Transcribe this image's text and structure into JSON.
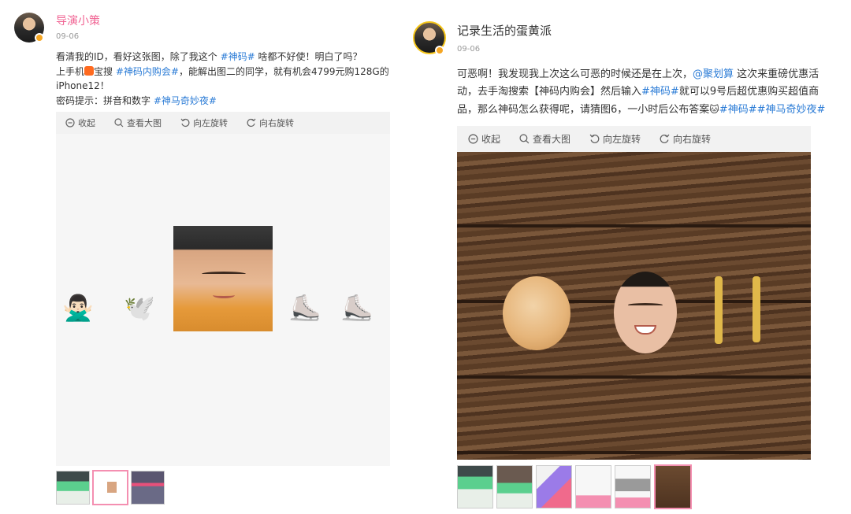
{
  "left_post": {
    "username": "导演小策",
    "date": "09-06",
    "text": {
      "l1_a": "看清我的ID，看好这张图，除了我这个 ",
      "l1_tag": "#神码#",
      "l1_b": " 啥都不好使！明白了吗？",
      "l2_a": "上手机",
      "l2_b": "宝搜 ",
      "l2_tag": "#神码内购会#",
      "l2_c": "，能解出图二的同学，就有机会4799元购128G的",
      "l3": "iPhone12！",
      "l4_a": "密码提示：拼音和数字   ",
      "l4_tag": "#神马奇妙夜#"
    },
    "toolbar": {
      "collapse": "收起",
      "view_large": "查看大图",
      "rotate_left": "向左旋转",
      "rotate_right": "向右旋转"
    },
    "rebus_emojis": {
      "e1": "🙅🏻‍♂️",
      "e2": "🕊️",
      "e3": "⛸️",
      "e4": "⛸️"
    }
  },
  "right_post": {
    "username": "记录生活的蛋黄派",
    "date": "09-06",
    "text": {
      "l1_a": "可恶啊！我发现我上次这么可恶的时候还是在上次，",
      "l1_mention": "@聚划算",
      "l1_b": " 这次来重磅优惠活",
      "l2_a": "动，去手淘搜索【神码内购会】然后输入",
      "l2_tag": "#神码#",
      "l2_b": "就可以9号后超优惠购买超值商",
      "l3_a": "品，那么神码怎么获得呢，请猜图6，一小时后公布答案",
      "l3_emoji": "🐱",
      "l3_tags": "#神码##神马奇妙夜#"
    },
    "toolbar": {
      "collapse": "收起",
      "view_large": "查看大图",
      "rotate_left": "向左旋转",
      "rotate_right": "向右旋转"
    }
  },
  "colors": {
    "link": "#2a7bd6",
    "left_username": "#f06292",
    "right_username": "#333333",
    "active_thumb_border": "#f48fb1"
  }
}
